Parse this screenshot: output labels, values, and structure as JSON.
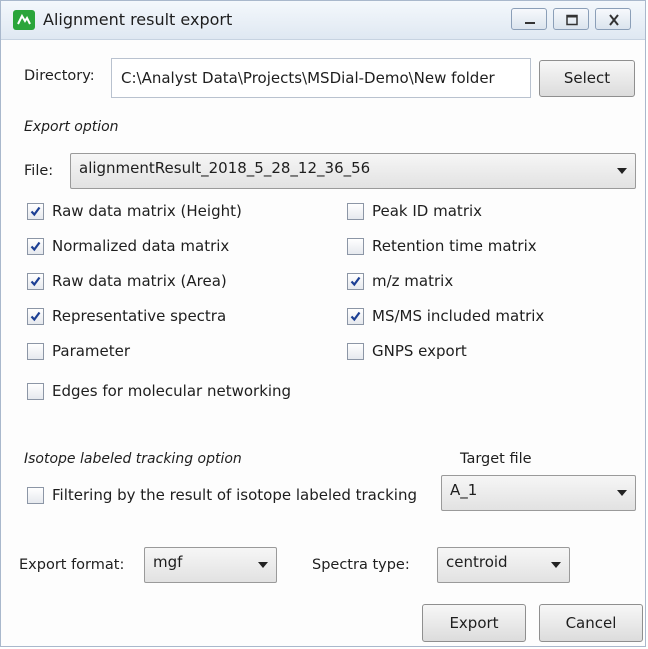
{
  "window": {
    "title": "Alignment result export"
  },
  "directory": {
    "label": "Directory:",
    "value": "C:\\Analyst Data\\Projects\\MSDial-Demo\\New folder",
    "select_label": "Select"
  },
  "export_option": {
    "heading": "Export option",
    "file_label": "File:",
    "file_value": "alignmentResult_2018_5_28_12_36_56",
    "options": [
      {
        "label": "Raw data matrix (Height)",
        "checked": true
      },
      {
        "label": "Peak ID matrix",
        "checked": false
      },
      {
        "label": "Normalized data matrix",
        "checked": true
      },
      {
        "label": "Retention time matrix",
        "checked": false
      },
      {
        "label": "Raw data matrix (Area)",
        "checked": true
      },
      {
        "label": "m/z matrix",
        "checked": true
      },
      {
        "label": "Representative spectra",
        "checked": true
      },
      {
        "label": "MS/MS included matrix",
        "checked": true
      },
      {
        "label": "Parameter",
        "checked": false
      },
      {
        "label": "GNPS export",
        "checked": false
      },
      {
        "label": "Edges for molecular networking",
        "checked": false
      }
    ]
  },
  "isotope": {
    "heading": "Isotope labeled tracking option",
    "target_file_label": "Target file",
    "filter_label": "Filtering by the result of isotope labeled tracking",
    "filter_checked": false,
    "target_file_value": "A_1"
  },
  "format": {
    "export_format_label": "Export format:",
    "export_format_value": "mgf",
    "spectra_type_label": "Spectra type:",
    "spectra_type_value": "centroid"
  },
  "actions": {
    "export_label": "Export",
    "cancel_label": "Cancel"
  }
}
